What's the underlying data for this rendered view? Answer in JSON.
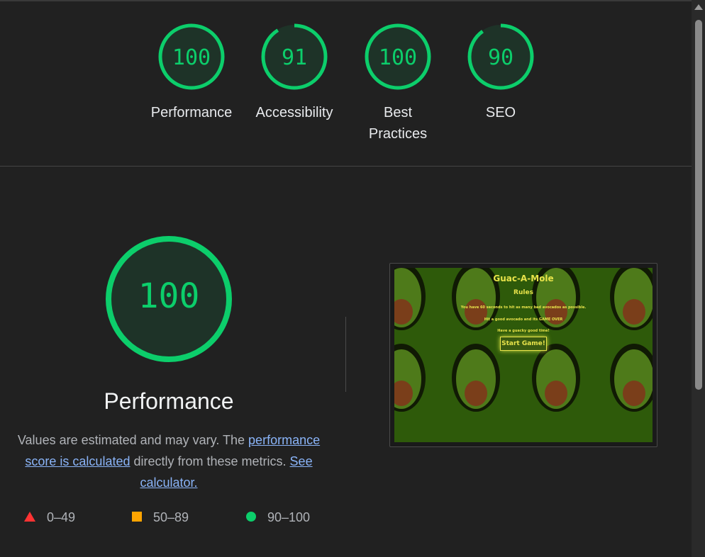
{
  "colors": {
    "pass": "#0cce6b",
    "average": "#ffa400",
    "fail": "#ff4e42",
    "link": "#8ab4f8"
  },
  "scores": [
    {
      "value": "100",
      "label": "Performance",
      "fraction": 1.0
    },
    {
      "value": "91",
      "label": "Accessibility",
      "fraction": 0.91
    },
    {
      "value": "100",
      "label": "Best Practices",
      "fraction": 1.0
    },
    {
      "value": "90",
      "label": "SEO",
      "fraction": 0.9
    }
  ],
  "main": {
    "score": "100",
    "fraction": 1.0,
    "title": "Performance",
    "desc_pre": "Values are estimated and may vary. The ",
    "link1": "performance score is calculated",
    "desc_mid": " directly from these metrics. ",
    "link2": "See calculator."
  },
  "legend": [
    {
      "icon": "triangle-icon",
      "range": "0–49"
    },
    {
      "icon": "square-icon",
      "range": "50–89"
    },
    {
      "icon": "circle-icon",
      "range": "90–100"
    }
  ],
  "screenshot": {
    "title": "Guac-A-Mole",
    "subtitle": "Rules",
    "line1": "You have 60 seconds to hit as many bad avocados as possible.",
    "line2": "Hit a good avocado and its GAME OVER",
    "line3": "Have a guacky good time!",
    "button": "Start Game!"
  }
}
